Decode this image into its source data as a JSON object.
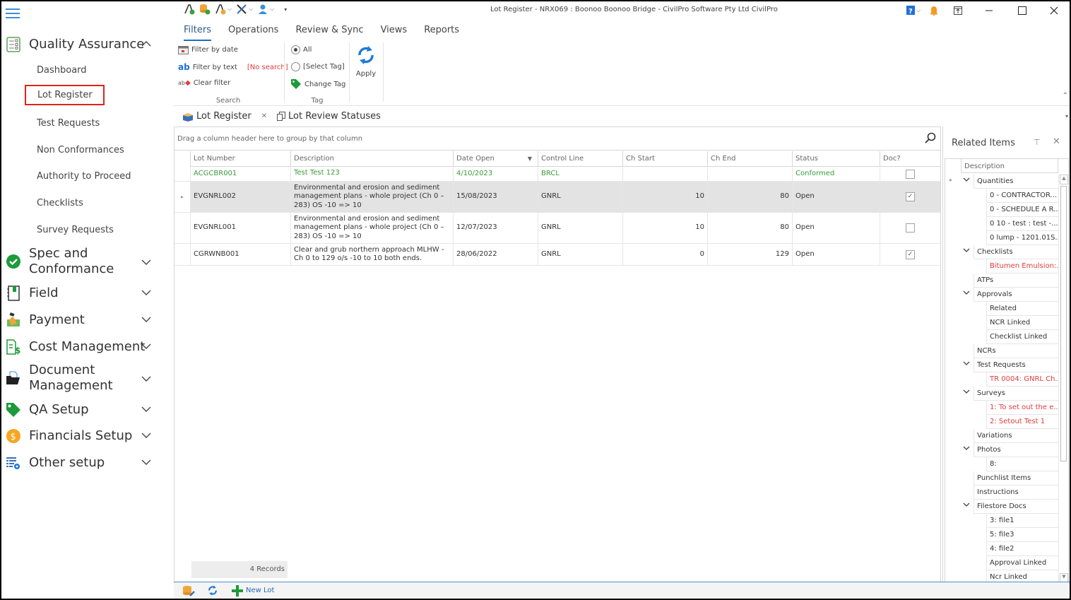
{
  "window": {
    "title": "Lot Register - NRX069 : Boonoo Boonoo Bridge - CivilPro Software Pty Ltd CivilPro"
  },
  "sidebar": {
    "groups": [
      {
        "label": "Quality Assurance",
        "icon": "checklist-icon",
        "expanded": true,
        "items": [
          "Dashboard",
          "Lot Register",
          "Test Requests",
          "Non Conformances",
          "Authority to Proceed",
          "Checklists",
          "Survey Requests"
        ],
        "active_item": "Lot Register"
      },
      {
        "label_line1": "Spec and",
        "label_line2": "Conformance",
        "icon": "check-circle-icon"
      },
      {
        "label": "Field",
        "icon": "field-book-icon"
      },
      {
        "label": "Payment",
        "icon": "payment-icon"
      },
      {
        "label": "Cost Management",
        "icon": "cost-doc-icon"
      },
      {
        "label_line1": "Document",
        "label_line2": "Management",
        "icon": "folder-icon"
      },
      {
        "label": "QA Setup",
        "icon": "tag-icon"
      },
      {
        "label": "Financials Setup",
        "icon": "dollar-coin-icon"
      },
      {
        "label": "Other setup",
        "icon": "settings-list-icon"
      }
    ]
  },
  "ribbon": {
    "tabs": [
      "Filters",
      "Operations",
      "Review & Sync",
      "Views",
      "Reports"
    ],
    "active_tab": "Filters",
    "search_group": {
      "title": "Search",
      "filter_by_date": "Filter by date",
      "filter_by_text": "Filter by text",
      "no_search": "[No search]",
      "clear_filter": "Clear filter"
    },
    "tag_group": {
      "title": "Tag",
      "all": "All",
      "select_tag": "[Select Tag]",
      "change_tag": "Change Tag",
      "selected": "All"
    },
    "apply_label": "Apply"
  },
  "doc_tabs": [
    {
      "label": "Lot Register",
      "closable": true,
      "active": true
    },
    {
      "label": "Lot Review Statuses",
      "closable": false
    }
  ],
  "grid": {
    "group_hint": "Drag a column header here to group by that column",
    "columns": [
      "Lot Number",
      "Description",
      "Date Open",
      "Control Line",
      "Ch Start",
      "Ch End",
      "Status",
      "Doc?"
    ],
    "sorted_column": "Date Open",
    "rows": [
      {
        "lot": "ACGCBR001",
        "desc": "Test Test 123",
        "date": "4/10/2023",
        "control": "BRCL",
        "ch_start": "",
        "ch_end": "",
        "status": "Conformed",
        "doc": false,
        "style": "green"
      },
      {
        "lot": "EVGNRL002",
        "desc": "Environmental and erosion and sediment management plans - whole project (Ch 0 – 283) OS -10 => 10",
        "date": "15/08/2023",
        "control": "GNRL",
        "ch_start": "10",
        "ch_end": "80",
        "status": "Open",
        "doc": true,
        "style": "selected"
      },
      {
        "lot": "EVGNRL001",
        "desc": "Environmental and erosion and sediment management plans - whole project (Ch 0 – 283) OS -10 => 10",
        "date": "12/07/2023",
        "control": "GNRL",
        "ch_start": "10",
        "ch_end": "80",
        "status": "Open",
        "doc": false,
        "style": ""
      },
      {
        "lot": "CGRWNB001",
        "desc": "Clear and grub northern approach MLHW - Ch 0 to 129  o/s -10 to 10 both ends.",
        "date": "28/06/2022",
        "control": "GNRL",
        "ch_start": "0",
        "ch_end": "129",
        "status": "Open",
        "doc": true,
        "style": ""
      }
    ],
    "record_count": "4 Records"
  },
  "bottom_toolbar": {
    "new_lot": "New Lot"
  },
  "related_items": {
    "title": "Related Items",
    "column": "Description",
    "tree": [
      {
        "label": "Quantities",
        "level": 0,
        "expanded": true
      },
      {
        "label": "0  - CONTRACTOR...",
        "level": 1
      },
      {
        "label": "0  - SCHEDULE A R...",
        "level": 1
      },
      {
        "label": "0 10 - test : test  -...",
        "level": 1
      },
      {
        "label": "0 lump - 1201.01S...",
        "level": 1
      },
      {
        "label": "Checklists",
        "level": 0,
        "expanded": true
      },
      {
        "label": "Bitumen Emulsion:...",
        "level": 1,
        "red": true
      },
      {
        "label": "ATPs",
        "level": 0
      },
      {
        "label": "Approvals",
        "level": 0,
        "expanded": true
      },
      {
        "label": "Related",
        "level": 1
      },
      {
        "label": "NCR Linked",
        "level": 1
      },
      {
        "label": "Checklist Linked",
        "level": 1
      },
      {
        "label": "NCRs",
        "level": 0
      },
      {
        "label": "Test Requests",
        "level": 0,
        "expanded": true
      },
      {
        "label": "TR 0004: GNRL Ch...",
        "level": 1,
        "red": true
      },
      {
        "label": "Surveys",
        "level": 0,
        "expanded": true
      },
      {
        "label": "1: To set out the e...",
        "level": 1,
        "red": true
      },
      {
        "label": "2: Setout Test 1",
        "level": 1,
        "red": true
      },
      {
        "label": "Variations",
        "level": 0
      },
      {
        "label": "Photos",
        "level": 0,
        "expanded": true
      },
      {
        "label": "8:",
        "level": 1
      },
      {
        "label": "Punchlist Items",
        "level": 0
      },
      {
        "label": "Instructions",
        "level": 0
      },
      {
        "label": "Filestore Docs",
        "level": 0,
        "expanded": true
      },
      {
        "label": "3: file1",
        "level": 1
      },
      {
        "label": "5: file3",
        "level": 1
      },
      {
        "label": "4: file2",
        "level": 1
      },
      {
        "label": "Approval Linked",
        "level": 1
      },
      {
        "label": "Ncr Linked",
        "level": 1
      }
    ]
  },
  "colors": {
    "accent": "#1f6fbf",
    "active_outline": "#e2231a",
    "conformed_green": "#3a9a3a",
    "warning_red": "#e23b3b"
  }
}
